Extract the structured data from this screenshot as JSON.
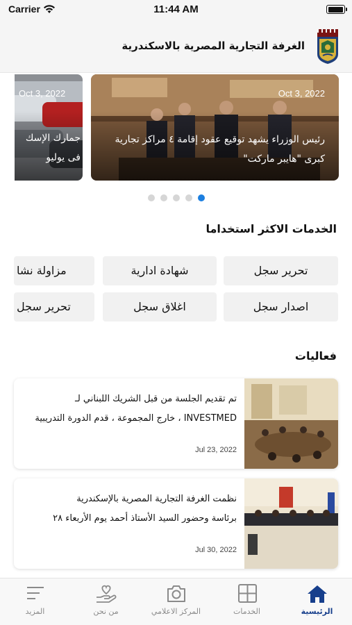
{
  "status_bar": {
    "carrier": "Carrier",
    "time": "11:44 AM"
  },
  "header": {
    "title": "الغرفة التجارية المصرية بالاسكندرية",
    "logo_icon": "chamber-crest-logo"
  },
  "carousel": {
    "slides": [
      {
        "date": "Oct 3, 2022",
        "line1": "رئيس الوزراء يشهد توقيع عقود إقامة ٤ مراكز تجارية",
        "line2": "كبرى \"هايبر ماركت\""
      },
      {
        "date": "Oct 3, 2022",
        "line1": "جمارك الإسك",
        "line2": "فى يوليو"
      }
    ],
    "dots": 5,
    "active_dot": 4
  },
  "services": {
    "title": "الخدمات الاكثر استخداما",
    "items": [
      "تحرير سجل",
      "شهادة ادارية",
      "مزاولة نشا",
      "اصدار سجل",
      "اغلاق سجل",
      "تحرير سجل"
    ]
  },
  "events": {
    "title": "فعاليات",
    "items": [
      {
        "line1": "تم تقديم الجلسة من قبل الشريك اللبناني لـ",
        "line2": "INVESTMED ، خارج المجموعة ، قدم الدورة التدريبية",
        "date": "Jul 23, 2022"
      },
      {
        "line1": "نظمت الغرفة التجارية المصرية بالإسكندرية",
        "line2": "برئاسة وحضور السيد الأستاذ أحمد يوم الأربعاء ٢٨",
        "date": "Jul 30, 2022"
      }
    ]
  },
  "tabs": [
    {
      "label": "الرئيسية",
      "icon": "home-icon",
      "active": true
    },
    {
      "label": "الخدمات",
      "icon": "grid-icon",
      "active": false
    },
    {
      "label": "المركز الاعلامي",
      "icon": "camera-icon",
      "active": false
    },
    {
      "label": "من نحن",
      "icon": "heart-hand-icon",
      "active": false
    },
    {
      "label": "المزيد",
      "icon": "menu-icon",
      "active": false
    }
  ],
  "colors": {
    "accent": "#1c7fe0",
    "tab_active": "#173f8c",
    "tab_inactive": "#8a8a8a"
  }
}
